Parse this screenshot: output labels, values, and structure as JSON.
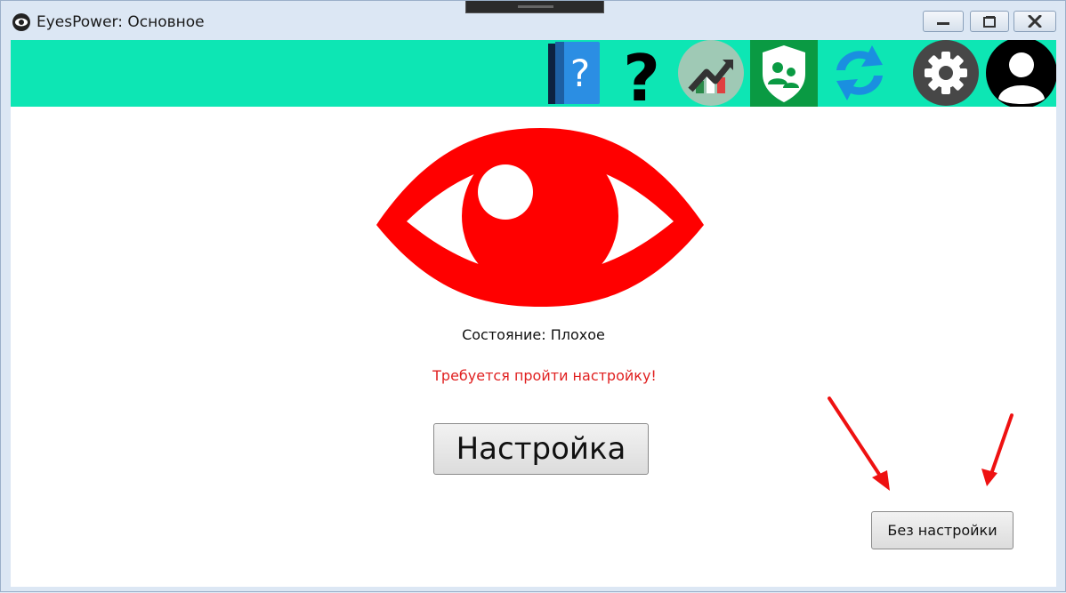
{
  "window": {
    "title": "EyesPower: Основное",
    "icon": "eye-logo-icon",
    "controls": [
      "minimize-icon",
      "maximize-icon",
      "close-icon"
    ]
  },
  "toolbar": {
    "background": "#0de6b4",
    "items": [
      {
        "name": "help-book",
        "icon": "help-book-icon"
      },
      {
        "name": "question",
        "icon": "question-mark-icon"
      },
      {
        "name": "statistics",
        "icon": "chart-trend-icon"
      },
      {
        "name": "parental-control",
        "icon": "shield-users-icon",
        "active": true
      },
      {
        "name": "update",
        "icon": "refresh-icon"
      },
      {
        "name": "settings",
        "icon": "gear-icon"
      },
      {
        "name": "account",
        "icon": "user-avatar-icon"
      }
    ]
  },
  "main": {
    "eye_icon": "eye-status-icon",
    "eye_color": "#ff0000",
    "status_text": "Состояние: Плохое",
    "warning_text": "Требуется пройти настройку!",
    "warning_color": "#e02020",
    "setup_button": "Настройка",
    "skip_button": "Без настройки"
  },
  "annotations": {
    "arrow_color": "#ee1111",
    "arrow_icon": "red-arrow-icon"
  }
}
